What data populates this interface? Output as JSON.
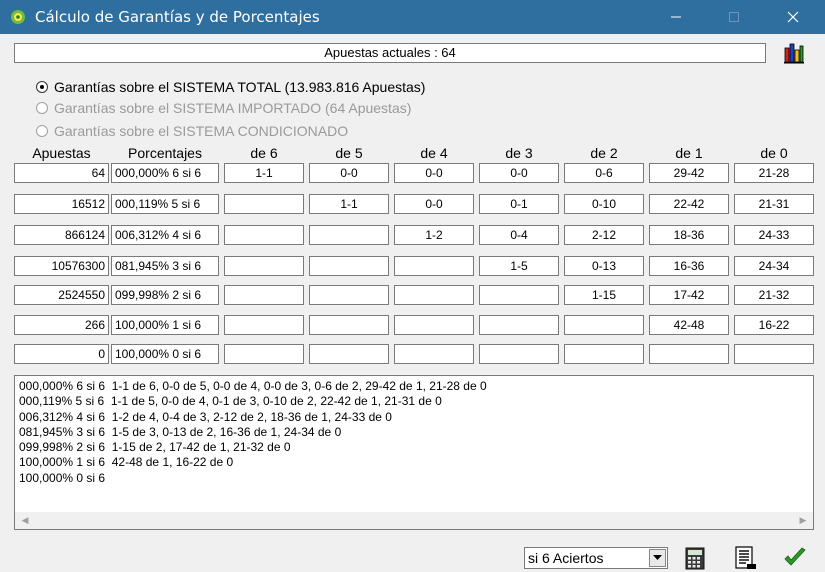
{
  "window": {
    "title": "Cálculo de Garantías y de Porcentajes",
    "minimize_icon": "minimize-icon",
    "maximize_icon": "maximize-icon",
    "close_icon": "close-icon",
    "titlebar_color": "#2f6f9f"
  },
  "apuestas_actuales": "Apuestas actuales : 64",
  "radios": [
    {
      "label": "Garantías sobre el SISTEMA TOTAL (13.983.816 Apuestas)",
      "checked": true,
      "enabled": true
    },
    {
      "label": "Garantías sobre el SISTEMA IMPORTADO (64 Apuestas)",
      "checked": false,
      "enabled": false
    },
    {
      "label": "Garantías sobre el SISTEMA CONDICIONADO",
      "checked": false,
      "enabled": false
    }
  ],
  "table": {
    "headers": [
      "Apuestas",
      "Porcentajes",
      "de 6",
      "de 5",
      "de 4",
      "de 3",
      "de 2",
      "de 1",
      "de 0"
    ],
    "rows": [
      {
        "apuestas": "64",
        "porcentaje": "000,000% 6 si 6",
        "de6": "1-1",
        "de5": "0-0",
        "de4": "0-0",
        "de3": "0-0",
        "de2": "0-6",
        "de1": "29-42",
        "de0": "21-28"
      },
      {
        "apuestas": "16512",
        "porcentaje": "000,119% 5 si 6",
        "de6": "",
        "de5": "1-1",
        "de4": "0-0",
        "de3": "0-1",
        "de2": "0-10",
        "de1": "22-42",
        "de0": "21-31"
      },
      {
        "apuestas": "866124",
        "porcentaje": "006,312% 4 si 6",
        "de6": "",
        "de5": "",
        "de4": "1-2",
        "de3": "0-4",
        "de2": "2-12",
        "de1": "18-36",
        "de0": "24-33"
      },
      {
        "apuestas": "10576300",
        "porcentaje": "081,945% 3 si 6",
        "de6": "",
        "de5": "",
        "de4": "",
        "de3": "1-5",
        "de2": "0-13",
        "de1": "16-36",
        "de0": "24-34"
      },
      {
        "apuestas": "2524550",
        "porcentaje": "099,998% 2 si 6",
        "de6": "",
        "de5": "",
        "de4": "",
        "de3": "",
        "de2": "1-15",
        "de1": "17-42",
        "de0": "21-32"
      },
      {
        "apuestas": "266",
        "porcentaje": "100,000% 1 si 6",
        "de6": "",
        "de5": "",
        "de4": "",
        "de3": "",
        "de2": "",
        "de1": "42-48",
        "de0": "16-22"
      },
      {
        "apuestas": "0",
        "porcentaje": "100,000% 0 si 6",
        "de6": "",
        "de5": "",
        "de4": "",
        "de3": "",
        "de2": "",
        "de1": "",
        "de0": ""
      }
    ]
  },
  "summary_lines": [
    "000,000% 6 si 6  1-1 de 6, 0-0 de 5, 0-0 de 4, 0-0 de 3, 0-6 de 2, 29-42 de 1, 21-28 de 0",
    "000,119% 5 si 6  1-1 de 5, 0-0 de 4, 0-1 de 3, 0-10 de 2, 22-42 de 1, 21-31 de 0",
    "006,312% 4 si 6  1-2 de 4, 0-4 de 3, 2-12 de 2, 18-36 de 1, 24-33 de 0",
    "081,945% 3 si 6  1-5 de 3, 0-13 de 2, 16-36 de 1, 24-34 de 0",
    "099,998% 2 si 6  1-15 de 2, 17-42 de 1, 21-32 de 0",
    "100,000% 1 si 6  42-48 de 1, 16-22 de 0",
    "100,000% 0 si 6"
  ],
  "combo": {
    "selected": "si 6 Aciertos"
  },
  "toolbar_icons": [
    "calculator-icon",
    "print-preview-icon",
    "checkmark-icon"
  ]
}
